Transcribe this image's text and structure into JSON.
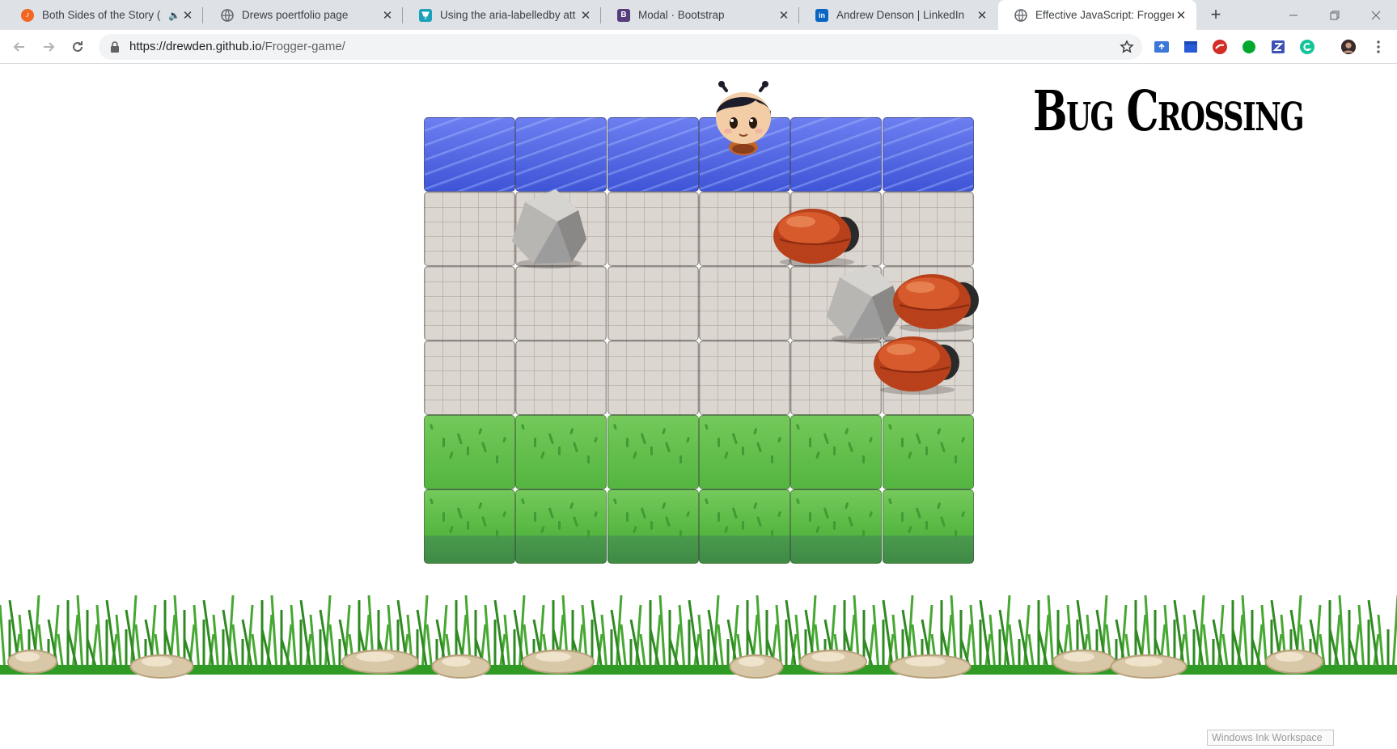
{
  "tabs": [
    {
      "title": "Both Sides of the Story (",
      "favicon": "music-note-icon",
      "audio": "speaker-icon"
    },
    {
      "title": "Drews poertfolio page",
      "favicon": "globe-icon"
    },
    {
      "title": "Using the aria-labelledby att",
      "favicon": "pin-icon"
    },
    {
      "title": "Modal · Bootstrap",
      "favicon": "bootstrap-icon",
      "letter": "B"
    },
    {
      "title": "Andrew Denson | LinkedIn",
      "favicon": "linkedin-icon",
      "letter": "in"
    },
    {
      "title": "Effective JavaScript: Frogger",
      "favicon": "globe-icon",
      "active": true
    }
  ],
  "omnibox": {
    "url_host": "https://drewden.github.io",
    "url_path": "/Frogger-game/"
  },
  "game": {
    "title": "Bug Crossing",
    "board": {
      "columns": 6,
      "rows": [
        "water",
        "stone",
        "stone",
        "stone",
        "grass",
        "grass"
      ]
    },
    "player": {
      "col": 3,
      "row": 0
    },
    "rocks": [
      {
        "col": 1,
        "row": 1
      },
      {
        "col": 4.3,
        "row": 2
      }
    ],
    "enemies": [
      {
        "col": 4.25,
        "row": 1
      },
      {
        "col": 5.1,
        "row": 2
      },
      {
        "col": 4.9,
        "row": 3
      }
    ]
  },
  "ink_workspace": "Windows Ink Workspace",
  "colors": {
    "water": "#4a5fe0",
    "stone": "#dcd6d0",
    "grass": "#5cbc48",
    "bug": "#c8461e",
    "tabstrip": "#dee1e6"
  }
}
